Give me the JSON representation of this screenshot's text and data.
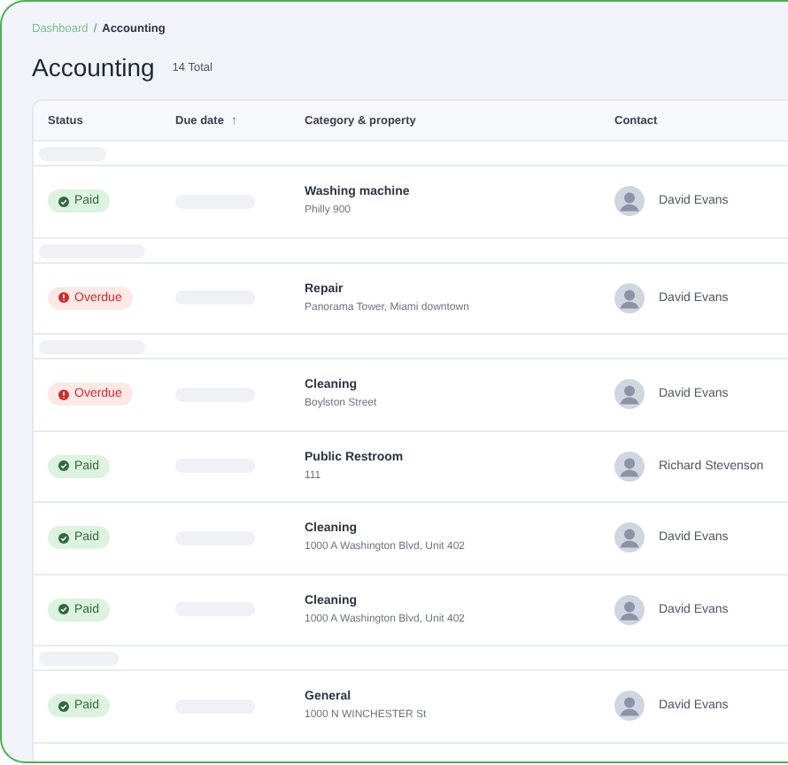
{
  "breadcrumb": [
    {
      "label": "Dashboard",
      "current": false
    },
    {
      "separator": "/",
      "label": "Accounting",
      "current": true
    }
  ],
  "page": {
    "title": "Accounting",
    "total": "14 Total"
  },
  "table": {
    "columns": [
      {
        "label": "Status"
      },
      {
        "label": "Due date",
        "sort_arrow": "↑"
      },
      {
        "label": "Category & property"
      },
      {
        "label": "Contact"
      }
    ],
    "rows": [
      {
        "kind": "group"
      },
      {
        "kind": "entry",
        "status": {
          "label": "Paid",
          "kind": "paid"
        },
        "category": "Washing machine",
        "property": "Philly 900",
        "contact": "David Evans"
      },
      {
        "kind": "group"
      },
      {
        "kind": "entry",
        "status": {
          "label": "Overdue",
          "kind": "overdue"
        },
        "category": "Repair",
        "property": "Panorama Tower, Miami downtown",
        "contact": "David Evans"
      },
      {
        "kind": "group"
      },
      {
        "kind": "entry",
        "status": {
          "label": "Overdue",
          "kind": "overdue"
        },
        "category": "Cleaning",
        "property": "Boylston Street",
        "contact": "David Evans"
      },
      {
        "kind": "entry",
        "status": {
          "label": "Paid",
          "kind": "paid"
        },
        "category": "Public Restroom",
        "property": "111",
        "contact": "Richard Stevenson"
      },
      {
        "kind": "entry",
        "status": {
          "label": "Paid",
          "kind": "paid"
        },
        "category": "Cleaning",
        "property": "1000 A Washington Blvd, Unit 402",
        "contact": "David Evans"
      },
      {
        "kind": "entry",
        "status": {
          "label": "Paid",
          "kind": "paid"
        },
        "category": "Cleaning",
        "property": "1000 A Washington Blvd, Unit 402",
        "contact": "David Evans"
      },
      {
        "kind": "group"
      },
      {
        "kind": "entry",
        "status": {
          "label": "Paid",
          "kind": "paid"
        },
        "category": "General",
        "property": "1000 N WINCHESTER St",
        "contact": "David Evans"
      }
    ]
  }
}
